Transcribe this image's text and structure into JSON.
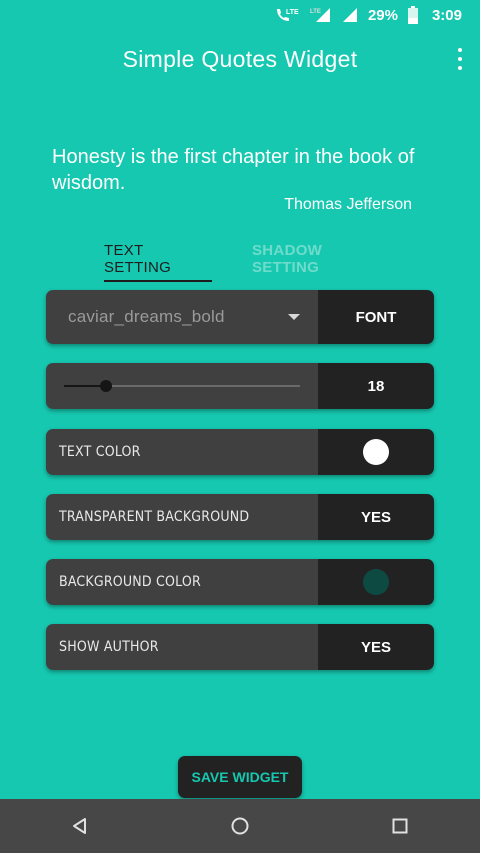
{
  "status_bar": {
    "network_label": "LTE",
    "network_label_2": "LTE",
    "battery_percent": "29%",
    "time": "3:09"
  },
  "app_bar": {
    "title": "Simple Quotes Widget",
    "overflow_icon": "more-vert-icon"
  },
  "preview": {
    "quote": "Honesty is the first chapter in the book of wisdom.",
    "author": "Thomas Jefferson"
  },
  "tabs": [
    {
      "label": "TEXT SETTING",
      "active": true
    },
    {
      "label": "SHADOW SETTING",
      "active": false
    }
  ],
  "settings": {
    "font": {
      "value": "caviar_dreams_bold",
      "button_label": "FONT"
    },
    "size": {
      "value": "18",
      "slider_fraction": 0.18
    },
    "text_color": {
      "label": "TEXT COLOR",
      "color": "#ffffff"
    },
    "transparent_background": {
      "label": "TRANSPARENT BACKGROUND",
      "value": "YES"
    },
    "background_color": {
      "label": "BACKGROUND COLOR",
      "color": "#0d4a42"
    },
    "show_author": {
      "label": "SHOW AUTHOR",
      "value": "YES"
    }
  },
  "save_button": {
    "label": "SAVE WIDGET"
  },
  "colors": {
    "accent": "#16c8b0",
    "panel_dark": "#222222",
    "panel_mid": "#404040"
  },
  "nav_bar": {
    "back_icon": "back-triangle-icon",
    "home_icon": "home-circle-icon",
    "recents_icon": "recents-square-icon"
  }
}
